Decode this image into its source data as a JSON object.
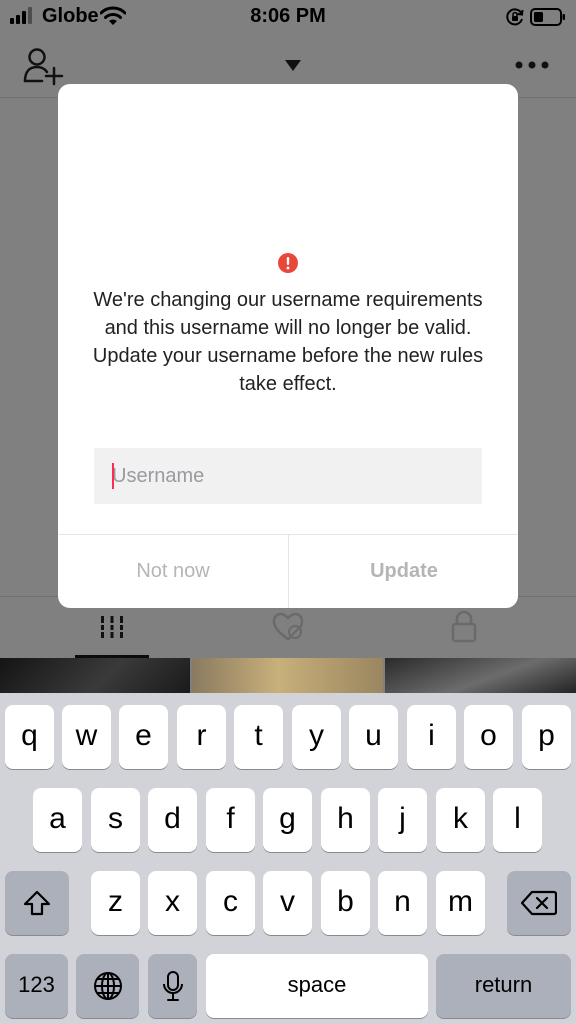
{
  "status_bar": {
    "carrier": "Globe",
    "time": "8:06 PM"
  },
  "header": {
    "icons": [
      "add-user-icon",
      "dropdown-caret-icon",
      "more-icon"
    ]
  },
  "tabs": {
    "icons": [
      "grid-icon",
      "liked-hidden-icon",
      "lock-icon"
    ],
    "active": "grid-icon"
  },
  "modal": {
    "icon": "alert-icon",
    "message": "We're changing our username requirements and this username will no longer be valid. Update your username before the new rules take effect.",
    "input_value": "",
    "input_placeholder": "Username",
    "not_now_label": "Not now",
    "update_label": "Update"
  },
  "keyboard": {
    "row1": [
      "q",
      "w",
      "e",
      "r",
      "t",
      "y",
      "u",
      "i",
      "o",
      "p"
    ],
    "row2": [
      "a",
      "s",
      "d",
      "f",
      "g",
      "h",
      "j",
      "k",
      "l"
    ],
    "row3": [
      "z",
      "x",
      "c",
      "v",
      "b",
      "n",
      "m"
    ],
    "numbers_label": "123",
    "space_label": "space",
    "return_label": "return",
    "icons": [
      "shift-icon",
      "backspace-icon",
      "globe-icon",
      "microphone-icon"
    ]
  },
  "colors": {
    "accent": "#fe2c55",
    "alert": "#e8483c",
    "dim_background": "#808080",
    "keyboard_background": "#d1d3d9"
  }
}
